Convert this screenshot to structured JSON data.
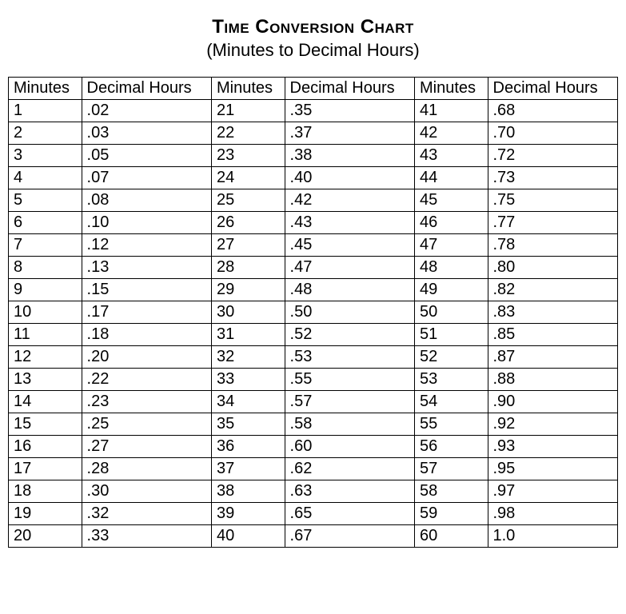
{
  "title": "Time Conversion Chart",
  "subtitle": "(Minutes to Decimal Hours)",
  "headers": {
    "minutes": "Minutes",
    "decimal": "Decimal Hours"
  },
  "chart_data": {
    "type": "table",
    "title": "Time Conversion Chart",
    "categories": [
      "Minutes",
      "Decimal Hours"
    ],
    "series": [
      {
        "minutes": 1,
        "decimal": ".02"
      },
      {
        "minutes": 2,
        "decimal": ".03"
      },
      {
        "minutes": 3,
        "decimal": ".05"
      },
      {
        "minutes": 4,
        "decimal": ".07"
      },
      {
        "minutes": 5,
        "decimal": ".08"
      },
      {
        "minutes": 6,
        "decimal": ".10"
      },
      {
        "minutes": 7,
        "decimal": ".12"
      },
      {
        "minutes": 8,
        "decimal": ".13"
      },
      {
        "minutes": 9,
        "decimal": ".15"
      },
      {
        "minutes": 10,
        "decimal": ".17"
      },
      {
        "minutes": 11,
        "decimal": ".18"
      },
      {
        "minutes": 12,
        "decimal": ".20"
      },
      {
        "minutes": 13,
        "decimal": ".22"
      },
      {
        "minutes": 14,
        "decimal": ".23"
      },
      {
        "minutes": 15,
        "decimal": ".25"
      },
      {
        "minutes": 16,
        "decimal": ".27"
      },
      {
        "minutes": 17,
        "decimal": ".28"
      },
      {
        "minutes": 18,
        "decimal": ".30"
      },
      {
        "minutes": 19,
        "decimal": ".32"
      },
      {
        "minutes": 20,
        "decimal": ".33"
      },
      {
        "minutes": 21,
        "decimal": ".35"
      },
      {
        "minutes": 22,
        "decimal": ".37"
      },
      {
        "minutes": 23,
        "decimal": ".38"
      },
      {
        "minutes": 24,
        "decimal": ".40"
      },
      {
        "minutes": 25,
        "decimal": ".42"
      },
      {
        "minutes": 26,
        "decimal": ".43"
      },
      {
        "minutes": 27,
        "decimal": ".45"
      },
      {
        "minutes": 28,
        "decimal": ".47"
      },
      {
        "minutes": 29,
        "decimal": ".48"
      },
      {
        "minutes": 30,
        "decimal": ".50"
      },
      {
        "minutes": 31,
        "decimal": ".52"
      },
      {
        "minutes": 32,
        "decimal": ".53"
      },
      {
        "minutes": 33,
        "decimal": ".55"
      },
      {
        "minutes": 34,
        "decimal": ".57"
      },
      {
        "minutes": 35,
        "decimal": ".58"
      },
      {
        "minutes": 36,
        "decimal": ".60"
      },
      {
        "minutes": 37,
        "decimal": ".62"
      },
      {
        "minutes": 38,
        "decimal": ".63"
      },
      {
        "minutes": 39,
        "decimal": ".65"
      },
      {
        "minutes": 40,
        "decimal": ".67"
      },
      {
        "minutes": 41,
        "decimal": ".68"
      },
      {
        "minutes": 42,
        "decimal": ".70"
      },
      {
        "minutes": 43,
        "decimal": ".72"
      },
      {
        "minutes": 44,
        "decimal": ".73"
      },
      {
        "minutes": 45,
        "decimal": ".75"
      },
      {
        "minutes": 46,
        "decimal": ".77"
      },
      {
        "minutes": 47,
        "decimal": ".78"
      },
      {
        "minutes": 48,
        "decimal": ".80"
      },
      {
        "minutes": 49,
        "decimal": ".82"
      },
      {
        "minutes": 50,
        "decimal": ".83"
      },
      {
        "minutes": 51,
        "decimal": ".85"
      },
      {
        "minutes": 52,
        "decimal": ".87"
      },
      {
        "minutes": 53,
        "decimal": ".88"
      },
      {
        "minutes": 54,
        "decimal": ".90"
      },
      {
        "minutes": 55,
        "decimal": ".92"
      },
      {
        "minutes": 56,
        "decimal": ".93"
      },
      {
        "minutes": 57,
        "decimal": ".95"
      },
      {
        "minutes": 58,
        "decimal": ".97"
      },
      {
        "minutes": 59,
        "decimal": ".98"
      },
      {
        "minutes": 60,
        "decimal": "1.0"
      }
    ]
  }
}
